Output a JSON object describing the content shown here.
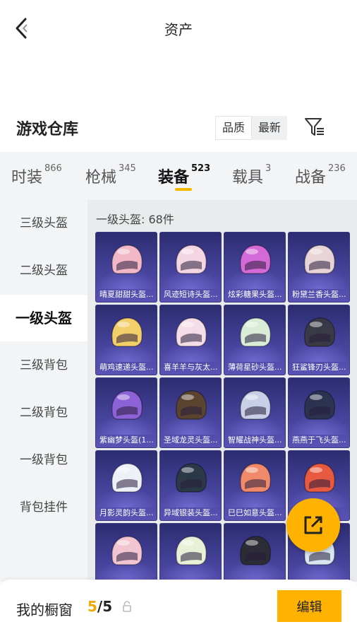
{
  "header": {
    "title": "资产"
  },
  "warehouse": {
    "title": "游戏仓库",
    "sort_options": [
      "品质",
      "最新"
    ],
    "active_sort": "品质"
  },
  "tabs": [
    {
      "label": "时装",
      "count": "866"
    },
    {
      "label": "枪械",
      "count": "345"
    },
    {
      "label": "装备",
      "count": "523"
    },
    {
      "label": "载具",
      "count": "3"
    },
    {
      "label": "战备",
      "count": "236"
    }
  ],
  "active_tab": "装备",
  "sidebar": {
    "items": [
      "三级头盔",
      "二级头盔",
      "一级头盔",
      "三级背包",
      "二级背包",
      "一级背包",
      "背包挂件"
    ],
    "active": "一级头盔"
  },
  "content": {
    "heading": "一级头盔: 68件",
    "items": [
      {
        "name": "晴夏甜甜头盔...",
        "color": "#f2b8c8"
      },
      {
        "name": "风迹短诗头盔...",
        "color": "#f4d6e2"
      },
      {
        "name": "炫彩糖果头盔...",
        "color": "#d46ad8"
      },
      {
        "name": "粉黛兰香头盔...",
        "color": "#e8d4d6"
      },
      {
        "name": "萌鸡速递头盔...",
        "color": "#f3cf6a"
      },
      {
        "name": "喜羊羊与灰太...",
        "color": "#f4dde6"
      },
      {
        "name": "薄荷星砂头盔...",
        "color": "#d8ecd8"
      },
      {
        "name": "狂鲨锋刃头盔...",
        "color": "#3a3a46"
      },
      {
        "name": "紫幽梦头盔(1...",
        "color": "#8d62d6"
      },
      {
        "name": "圣域龙灵头盔...",
        "color": "#5a4430"
      },
      {
        "name": "智耀战神头盔...",
        "color": "#c8cfe6"
      },
      {
        "name": "燕燕于飞头盔...",
        "color": "#2c3350"
      },
      {
        "name": "月影灵韵头盔...",
        "color": "#eef0f8"
      },
      {
        "name": "异域银装头盔...",
        "color": "#2a3848"
      },
      {
        "name": "巳巳如意头盔...",
        "color": "#f08a6a"
      },
      {
        "name": "",
        "color": "#e85a40"
      },
      {
        "name": "",
        "color": "#f2c6d0"
      },
      {
        "name": "",
        "color": "#e8f0d8"
      },
      {
        "name": "",
        "color": "#2c2c36"
      },
      {
        "name": "",
        "color": "#d8e6f2"
      }
    ]
  },
  "bottom": {
    "label": "我的橱窗",
    "count_current": "5",
    "count_sep_total": "/5",
    "edit_label": "编辑"
  }
}
